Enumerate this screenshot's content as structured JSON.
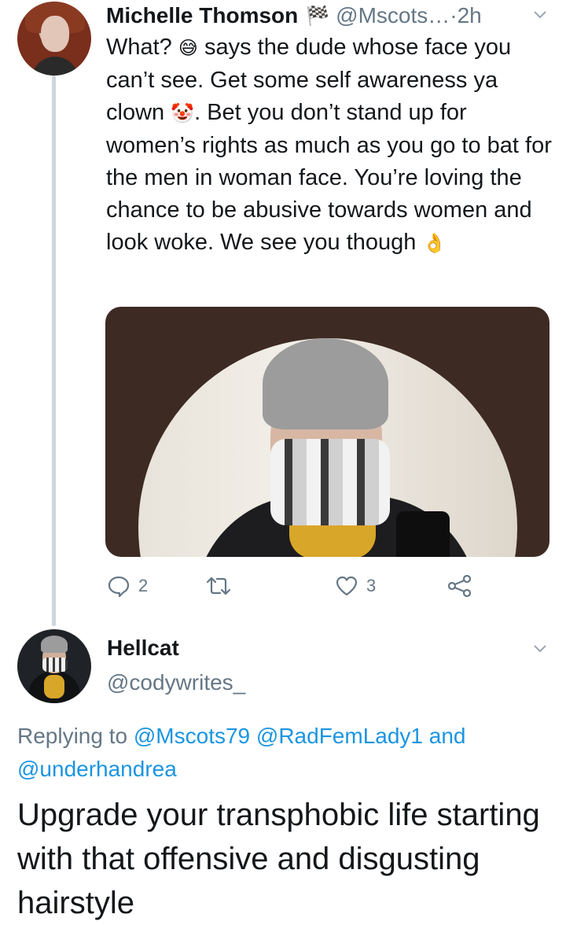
{
  "tweet1": {
    "display_name": "Michelle Thomson",
    "flag_glyph": "🏁",
    "handle": "@Mscots…",
    "separator": " · ",
    "time": "2h",
    "text_part1": "What? ",
    "emoji1": "😅",
    "text_part2": " says the dude whose face you can’t see. Get some self awareness ya clown ",
    "emoji2": "🤡",
    "text_part3": ". Bet you don’t stand up for women’s rights as much as you go to bat for the men in woman face. You’re loving the chance to be abusive towards women and look woke. We see you though ",
    "emoji3": "👌",
    "actions": {
      "reply_count": "2",
      "retweet_count": "",
      "like_count": "3"
    }
  },
  "tweet2": {
    "display_name": "Hellcat",
    "handle": "@codywrites_",
    "replying_prefix": "Replying to ",
    "mention1": "@Mscots79",
    "mention2": "@RadFemLady1",
    "and_word": "and",
    "mention3": "@underhandrea",
    "text": "Upgrade your transphobic life starting with that offensive and disgusting hairstyle"
  },
  "colors": {
    "text": "#14171a",
    "secondary": "#657786",
    "link": "#1b95e0",
    "thread_line": "#ccd6dd"
  }
}
